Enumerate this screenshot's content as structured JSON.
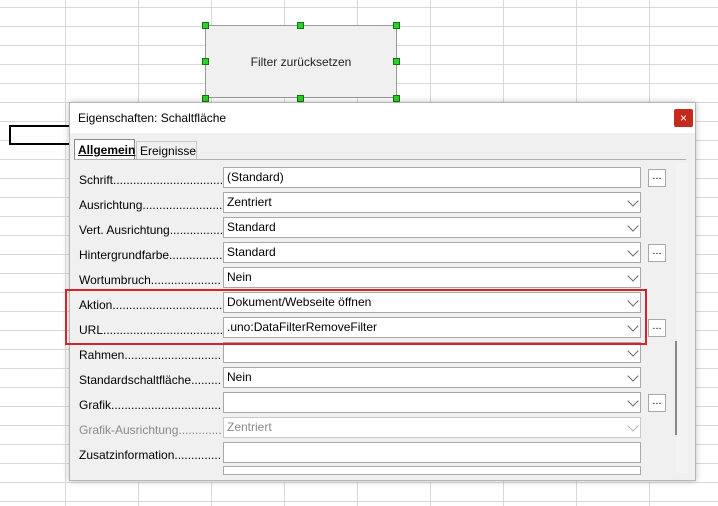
{
  "form_button": {
    "label": "Filter zurücksetzen"
  },
  "dialog": {
    "title": "Eigenschaften: Schaltfläche",
    "close_glyph": "×",
    "tabs": [
      {
        "label": "Allgemein",
        "active": true
      },
      {
        "label": "Ereignisse",
        "active": false
      }
    ],
    "ellipsis_label": "...",
    "properties": [
      {
        "label": "Schrift......................................",
        "value": "(Standard)"
      },
      {
        "label": "Ausrichtung..........................",
        "value": "Zentriert"
      },
      {
        "label": "Vert. Ausrichtung.................",
        "value": "Standard"
      },
      {
        "label": "Hintergrundfarbe.................",
        "value": "Standard"
      },
      {
        "label": "Wortumbruch......................",
        "value": "Nein"
      },
      {
        "label": "Aktion.....................................",
        "value": "Dokument/Webseite öffnen"
      },
      {
        "label": "URL............................................",
        "value": ".uno:DataFilterRemoveFilter"
      },
      {
        "label": "Rahmen.................................",
        "value": ""
      },
      {
        "label": "Standardschaltfläche.........",
        "value": "Nein"
      },
      {
        "label": "Grafik.........................................",
        "value": ""
      },
      {
        "label": "Grafik-Ausrichtung.............",
        "value": "Zentriert"
      },
      {
        "label": "Zusatzinformation...............",
        "value": ""
      }
    ]
  },
  "colors": {
    "highlight": "#d9232a",
    "handle": "#2bd02b",
    "close": "#c42b1c"
  }
}
